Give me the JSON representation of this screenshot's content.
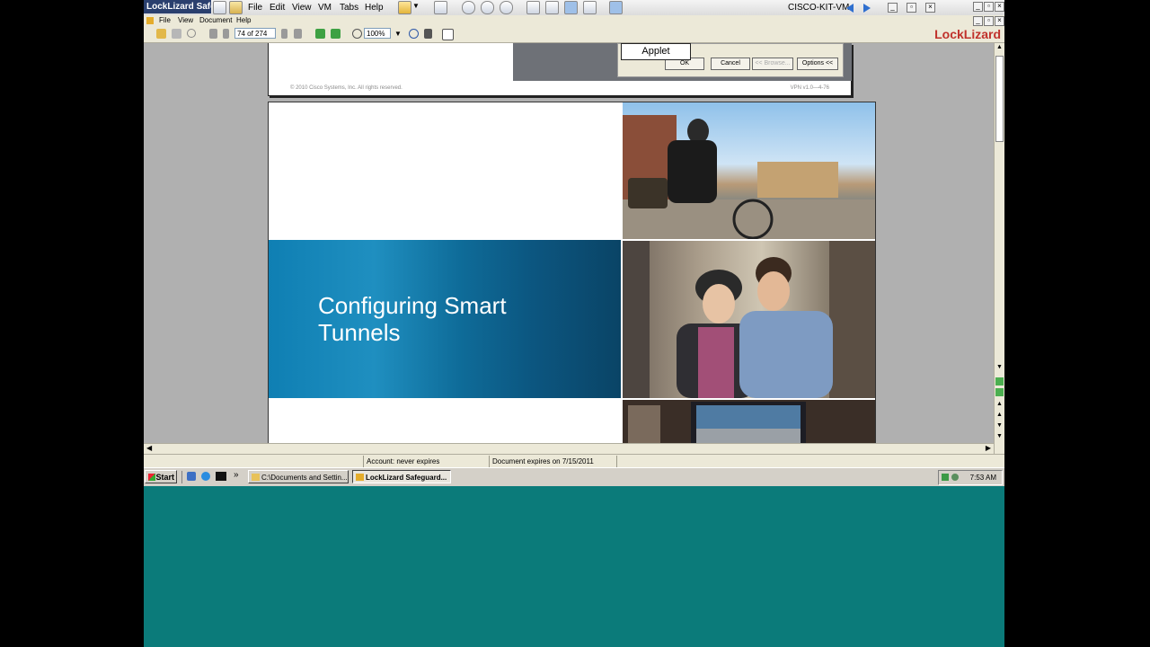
{
  "vm_bar": {
    "app_title": "LockLizard Safe",
    "menus": [
      "File",
      "Edit",
      "View",
      "VM",
      "Tabs",
      "Help"
    ],
    "vm_name": "CISCO-KIT-VM"
  },
  "app_menu": [
    "File",
    "View",
    "Document",
    "Help"
  ],
  "toolbar": {
    "page_indicator": "74 of 274",
    "zoom": "100%",
    "logo": "LockLizard"
  },
  "page_prev": {
    "dialog_lang": "EN",
    "ok_label": "OK",
    "cancel_label": "Cancel",
    "disabled_label": "<< Browse...",
    "options_label": "Options <<",
    "applet_label": "Applet",
    "copyright": "© 2010 Cisco Systems, Inc. All rights reserved.",
    "course_ref": "VPN v1.0—4-76"
  },
  "slide": {
    "title_line1": "Configuring Smart",
    "title_line2": "Tunnels"
  },
  "status": {
    "account": "Account: never expires",
    "document": "Document expires on 7/15/2011"
  },
  "taskbar": {
    "start_label": "Start",
    "items": [
      "C:\\Documents and Settin...",
      "LockLizard Safeguard..."
    ],
    "overflow": "»",
    "clock": "7:53 AM"
  },
  "colors": {
    "desktop": "#0b7b7a",
    "banner_blue": "#0f7fb3",
    "logo_red": "#c0312b"
  }
}
